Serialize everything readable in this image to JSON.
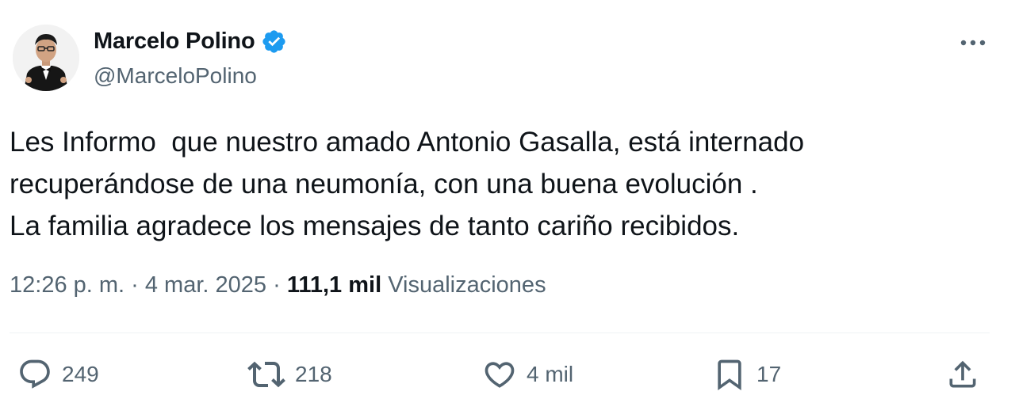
{
  "author": {
    "display_name": "Marcelo Polino",
    "handle": "@MarceloPolino",
    "verified": true
  },
  "tweet": {
    "lines": [
      "Les Informo  que nuestro amado Antonio Gasalla, está internado",
      "recuperándose de una neumonía, con una buena evolución .",
      "La familia agradece los mensajes de tanto cariño recibidos."
    ]
  },
  "meta": {
    "time": "12:26 p. m.",
    "separator": " · ",
    "date": "4 mar. 2025",
    "views_count": "111,1 mil",
    "views_label": "Visualizaciones"
  },
  "actions": {
    "replies": "249",
    "reposts": "218",
    "likes": "4 mil",
    "bookmarks": "17"
  },
  "icons": {
    "more": "more-horizontal-icon",
    "verified": "verified-badge-icon",
    "reply": "reply-icon",
    "repost": "repost-icon",
    "like": "heart-icon",
    "bookmark": "bookmark-icon",
    "share": "share-icon"
  },
  "colors": {
    "text_primary": "#0f1419",
    "text_secondary": "#536471",
    "verified_blue": "#1d9bf0",
    "divider": "#eff3f4"
  }
}
